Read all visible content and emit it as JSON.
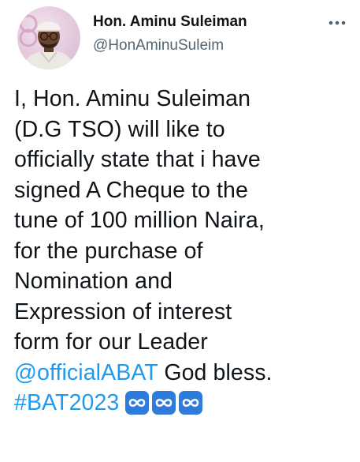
{
  "author": {
    "display_name": "Hon. Aminu Suleiman",
    "handle": "@HonAminuSuleim"
  },
  "tweet": {
    "lines": [
      "I, Hon. Aminu Suleiman",
      "(D.G TSO) will like to",
      "officially state that i have",
      "signed A Cheque to the",
      "tune of 100 million Naira,",
      "for the purchase of",
      "Nomination and",
      "Expression of interest",
      "form for our Leader"
    ],
    "mention": "@officialABAT",
    "after_mention": " God bless.",
    "hashtag": "#BAT2023",
    "emojis": [
      "infinity-icon",
      "infinity-icon",
      "infinity-icon"
    ]
  },
  "colors": {
    "link": "#1d9bf0",
    "text": "#0f1419",
    "secondary": "#536471",
    "emoji_bg": "#2e7bdc"
  },
  "icons": {
    "more": "more-horizontal-icon",
    "avatar": "profile-photo"
  }
}
